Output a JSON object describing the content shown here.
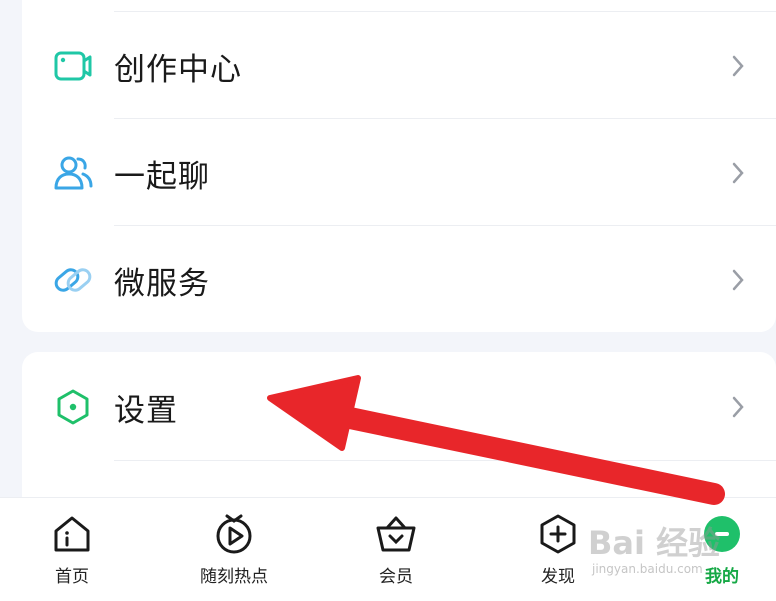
{
  "menu_top": {
    "items": [
      {
        "label": "创作中心",
        "icon": "video-camera-icon"
      },
      {
        "label": "一起聊",
        "icon": "users-icon"
      },
      {
        "label": "微服务",
        "icon": "link-icon"
      }
    ]
  },
  "menu_bottom": {
    "items": [
      {
        "label": "设置",
        "icon": "hexagon-settings-icon"
      }
    ]
  },
  "tabbar": {
    "tabs": [
      {
        "label": "首页",
        "icon": "home-icon",
        "active": false
      },
      {
        "label": "随刻热点",
        "icon": "play-circle-icon",
        "active": false
      },
      {
        "label": "会员",
        "icon": "vip-basket-icon",
        "active": false
      },
      {
        "label": "发现",
        "icon": "plus-hexagon-icon",
        "active": false
      },
      {
        "label": "我的",
        "icon": "profile-icon",
        "active": true
      }
    ]
  },
  "watermark": {
    "logo": "Bai 经验",
    "url": "jingyan.baidu.com"
  },
  "colors": {
    "accent_green": "#15a845",
    "teal_icon": "#1fc7a6",
    "blue_icon": "#3aa6e6",
    "hex_icon": "#1fc06a",
    "arrow_red": "#e8262a"
  }
}
